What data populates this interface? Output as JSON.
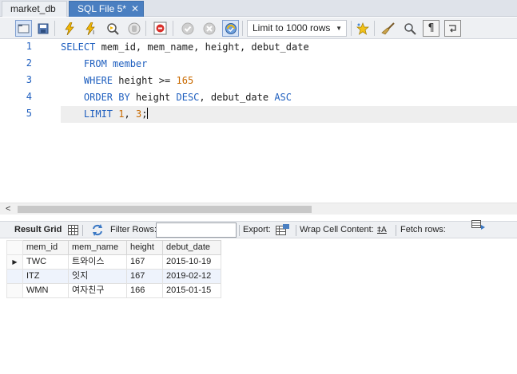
{
  "tabs": [
    {
      "label": "market_db",
      "active": false
    },
    {
      "label": "SQL File 5*",
      "active": true,
      "close": "✕"
    }
  ],
  "toolbar": {
    "limit_label": "Limit to 1000 rows",
    "buttons": [
      "open-folder-icon",
      "save-icon",
      "execute-icon",
      "execute-current-icon",
      "explain-icon",
      "stop-icon",
      "toggle-error-stop-icon",
      "commit-icon",
      "rollback-icon",
      "autocommit-icon",
      "beautify-star-icon",
      "format-broom-icon",
      "find-icon",
      "invisible-chars-icon",
      "wrap-icon"
    ]
  },
  "editor": {
    "line_numbers": [
      "1",
      "2",
      "3",
      "4",
      "5"
    ],
    "lines": [
      {
        "tokens": [
          {
            "t": "SELECT",
            "c": "kw"
          },
          {
            "t": " mem_id, mem_name, height, debut_date",
            "c": ""
          }
        ]
      },
      {
        "tokens": [
          {
            "t": "    FROM",
            "c": "kw"
          },
          {
            "t": " member",
            "c": "kw"
          }
        ]
      },
      {
        "tokens": [
          {
            "t": "    WHERE",
            "c": "kw"
          },
          {
            "t": " height >= ",
            "c": ""
          },
          {
            "t": "165",
            "c": "num"
          }
        ]
      },
      {
        "tokens": [
          {
            "t": "    ORDER BY",
            "c": "kw"
          },
          {
            "t": " height ",
            "c": ""
          },
          {
            "t": "DESC",
            "c": "kw"
          },
          {
            "t": ", debut_date ",
            "c": ""
          },
          {
            "t": "ASC",
            "c": "kw"
          }
        ]
      },
      {
        "tokens": [
          {
            "t": "    LIMIT",
            "c": "kw"
          },
          {
            "t": " ",
            "c": ""
          },
          {
            "t": "1",
            "c": "num"
          },
          {
            "t": ", ",
            "c": ""
          },
          {
            "t": "3",
            "c": "num"
          },
          {
            "t": ";",
            "c": ""
          }
        ]
      }
    ]
  },
  "scrollbar": {
    "left_arrow": "<"
  },
  "result_toolbar": {
    "result_grid": "Result Grid",
    "filter_rows": "Filter Rows:",
    "filter_value": "",
    "export": "Export:",
    "wrap_cell": "Wrap Cell Content:",
    "wrap_icon": "‡A",
    "fetch_rows": "Fetch rows:"
  },
  "grid": {
    "row_marker": "▶",
    "columns": [
      "mem_id",
      "mem_name",
      "height",
      "debut_date"
    ],
    "rows": [
      [
        "TWC",
        "트와이스",
        "167",
        "2015-10-19"
      ],
      [
        "ITZ",
        "잇지",
        "167",
        "2019-02-12"
      ],
      [
        "WMN",
        "여자친구",
        "166",
        "2015-01-15"
      ]
    ]
  },
  "colors": {
    "accent": "#4a7fc1",
    "keyword": "#1f5fbf",
    "number": "#c96a00"
  }
}
